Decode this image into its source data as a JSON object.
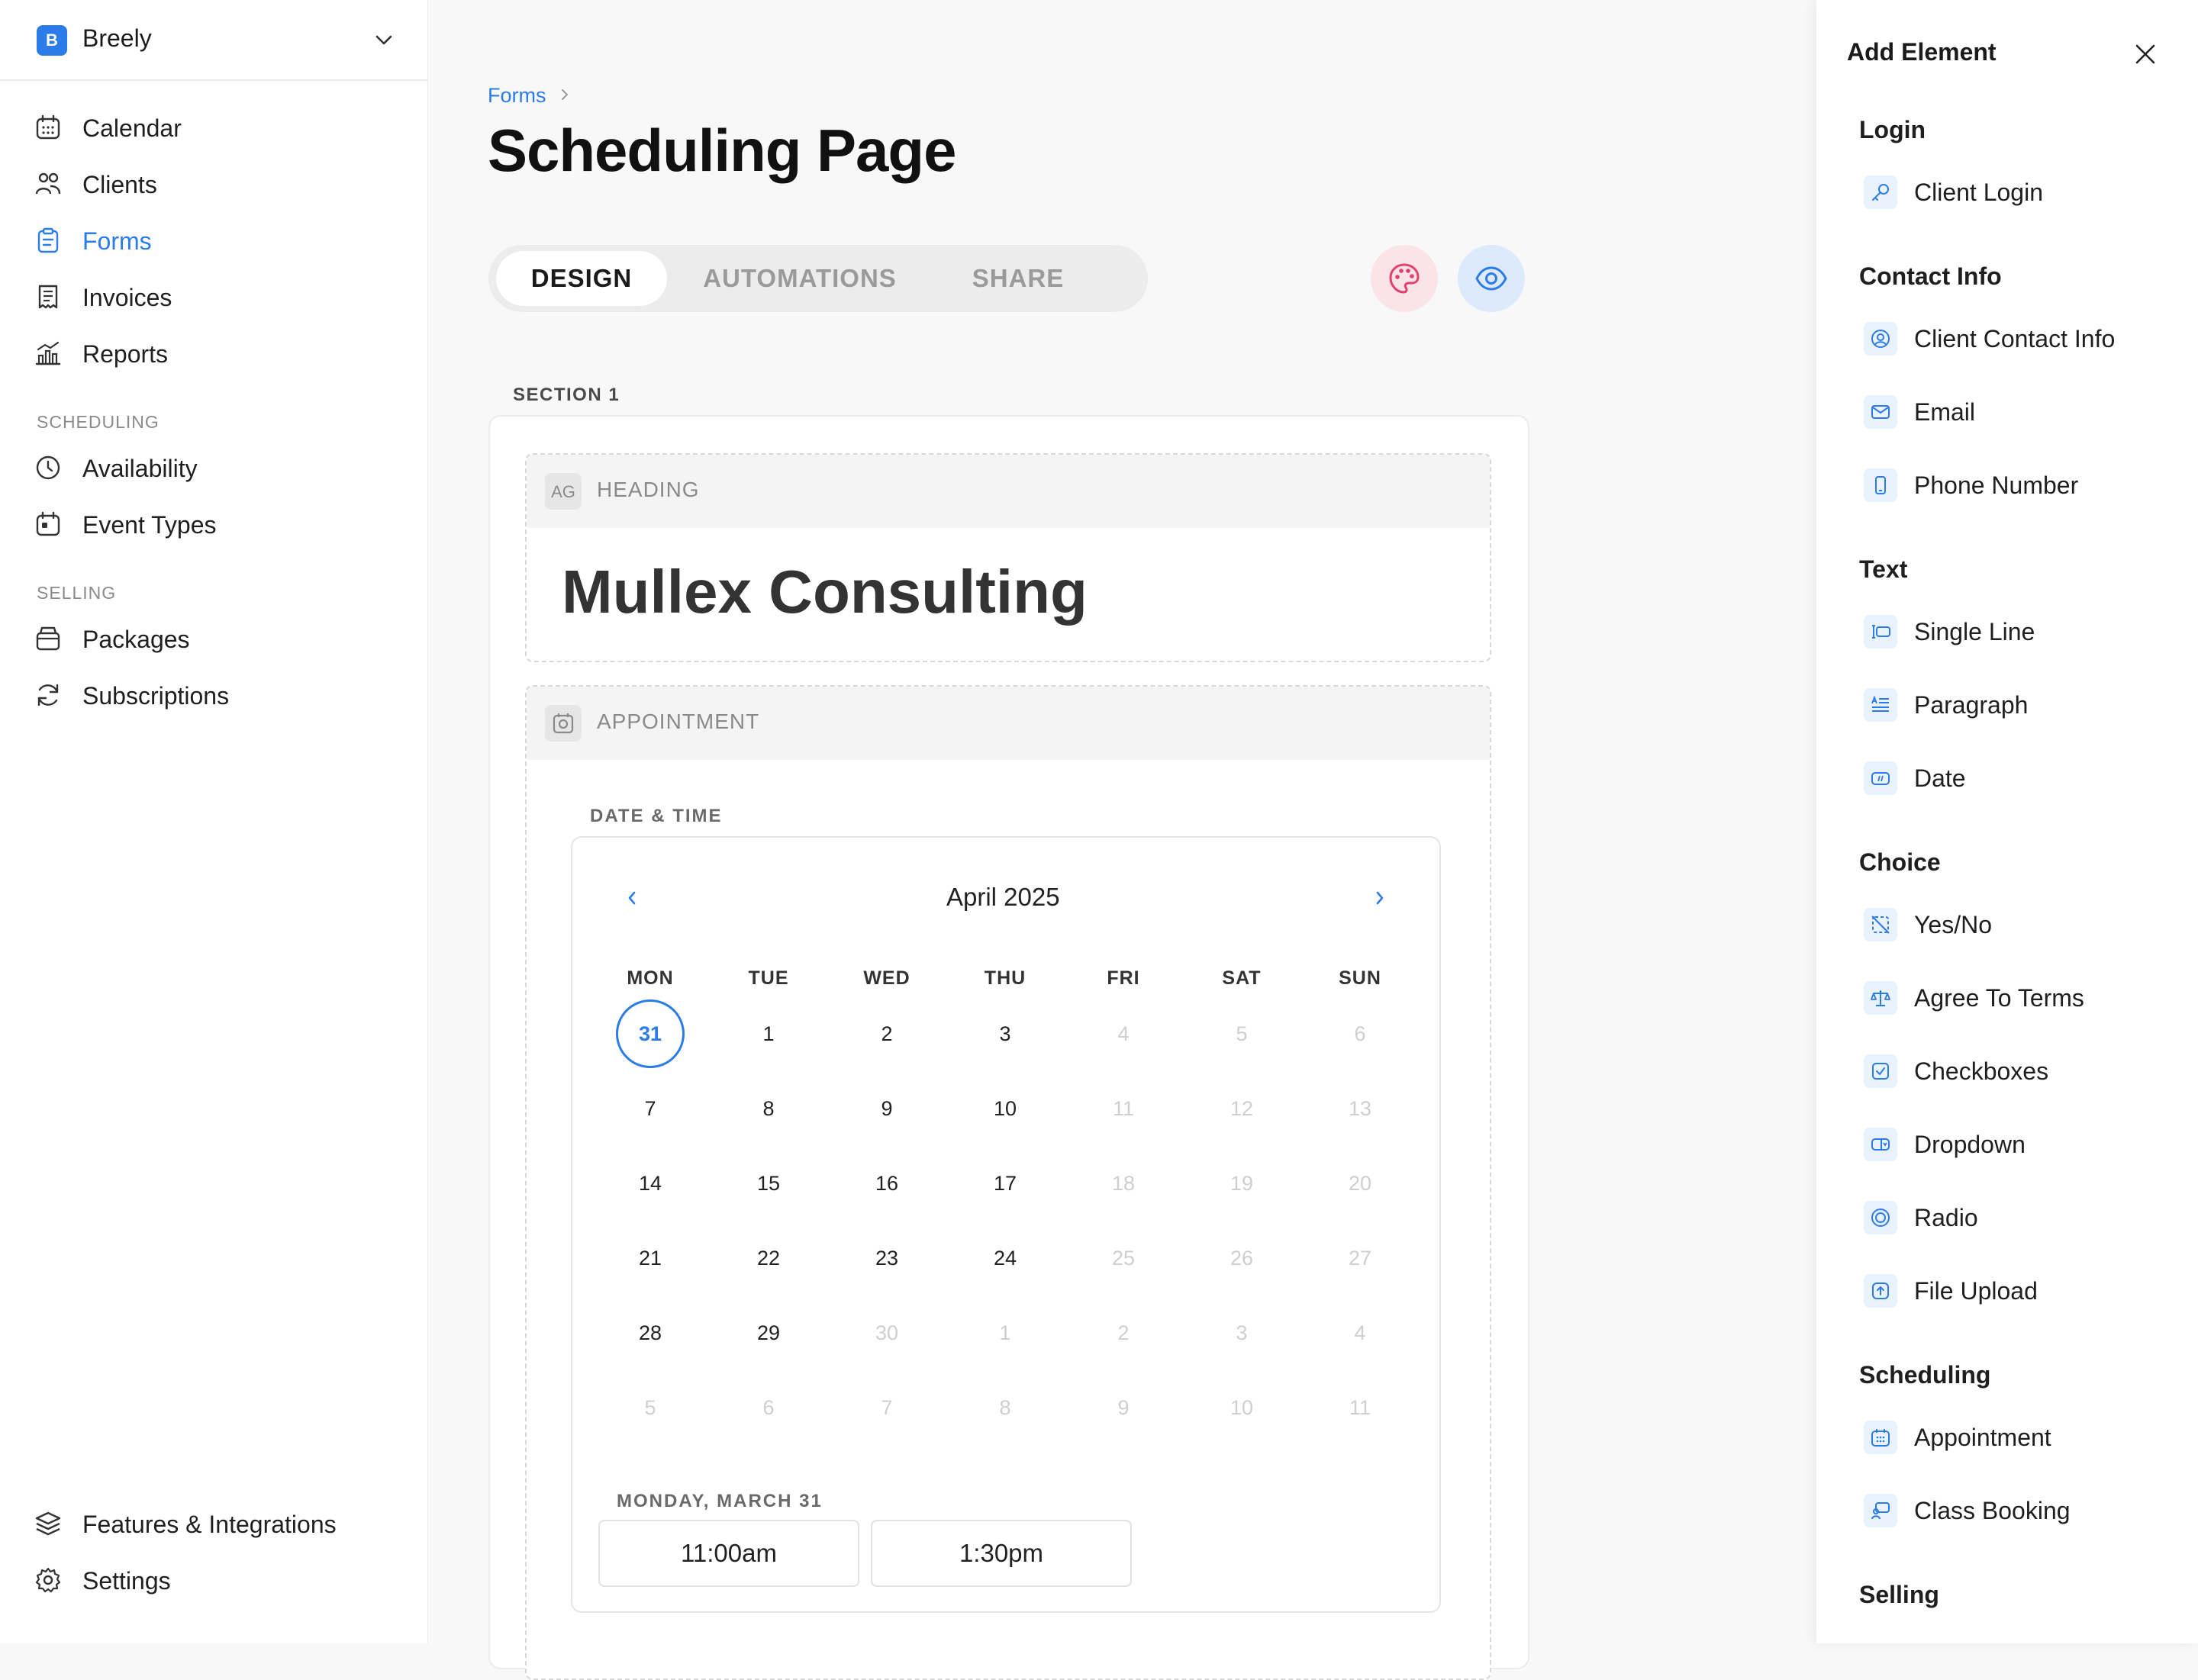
{
  "workspace": {
    "badge": "B",
    "name": "Breely"
  },
  "sidebar": {
    "items": [
      {
        "label": "Calendar"
      },
      {
        "label": "Clients"
      },
      {
        "label": "Forms"
      },
      {
        "label": "Invoices"
      },
      {
        "label": "Reports"
      }
    ],
    "scheduling_group": "SCHEDULING",
    "scheduling_items": [
      {
        "label": "Availability"
      },
      {
        "label": "Event Types"
      }
    ],
    "selling_group": "SELLING",
    "selling_items": [
      {
        "label": "Packages"
      },
      {
        "label": "Subscriptions"
      }
    ],
    "bottom_items": [
      {
        "label": "Features & Integrations"
      },
      {
        "label": "Settings"
      }
    ]
  },
  "breadcrumb": {
    "parent": "Forms"
  },
  "page": {
    "title": "Scheduling Page"
  },
  "tabs": [
    {
      "label": "DESIGN"
    },
    {
      "label": "AUTOMATIONS"
    },
    {
      "label": "SHARE"
    }
  ],
  "section": {
    "label": "SECTION 1"
  },
  "heading_block": {
    "type_label": "HEADING",
    "icon_text": "AG",
    "text": "Mullex Consulting"
  },
  "appointment_block": {
    "type_label": "APPOINTMENT",
    "field_label": "DATE & TIME"
  },
  "calendar": {
    "month": "April 2025",
    "weekdays": [
      "MON",
      "TUE",
      "WED",
      "THU",
      "FRI",
      "SAT",
      "SUN"
    ],
    "weeks": [
      [
        "31",
        "1",
        "2",
        "3",
        "4",
        "5",
        "6"
      ],
      [
        "7",
        "8",
        "9",
        "10",
        "11",
        "12",
        "13"
      ],
      [
        "14",
        "15",
        "16",
        "17",
        "18",
        "19",
        "20"
      ],
      [
        "21",
        "22",
        "23",
        "24",
        "25",
        "26",
        "27"
      ],
      [
        "28",
        "29",
        "30",
        "1",
        "2",
        "3",
        "4"
      ],
      [
        "5",
        "6",
        "7",
        "8",
        "9",
        "10",
        "11"
      ]
    ],
    "selected_date_label": "MONDAY, MARCH 31",
    "time_slots": [
      "11:00am",
      "1:30pm"
    ]
  },
  "panel": {
    "title": "Add Element",
    "categories": [
      {
        "name": "Login",
        "items": [
          {
            "label": "Client Login",
            "icon": "key-icon"
          }
        ]
      },
      {
        "name": "Contact Info",
        "items": [
          {
            "label": "Client Contact Info",
            "icon": "user-circle-icon"
          },
          {
            "label": "Email",
            "icon": "mail-icon"
          },
          {
            "label": "Phone Number",
            "icon": "phone-icon"
          }
        ]
      },
      {
        "name": "Text",
        "items": [
          {
            "label": "Single Line",
            "icon": "text-cursor-icon"
          },
          {
            "label": "Paragraph",
            "icon": "paragraph-icon"
          },
          {
            "label": "Date",
            "icon": "date-icon"
          }
        ]
      },
      {
        "name": "Choice",
        "items": [
          {
            "label": "Yes/No",
            "icon": "toggle-slash-icon"
          },
          {
            "label": "Agree To Terms",
            "icon": "scale-icon"
          },
          {
            "label": "Checkboxes",
            "icon": "checkbox-icon"
          },
          {
            "label": "Dropdown",
            "icon": "dropdown-icon"
          },
          {
            "label": "Radio",
            "icon": "radio-icon"
          },
          {
            "label": "File Upload",
            "icon": "upload-icon"
          }
        ]
      },
      {
        "name": "Scheduling",
        "items": [
          {
            "label": "Appointment",
            "icon": "calendar-icon"
          },
          {
            "label": "Class Booking",
            "icon": "class-icon"
          }
        ]
      },
      {
        "name": "Selling",
        "items": []
      }
    ]
  },
  "colors": {
    "accent": "#2b7be9",
    "palette_bg": "#fbe4e8",
    "palette_fg": "#e0426c",
    "preview_bg": "#dceafc"
  }
}
